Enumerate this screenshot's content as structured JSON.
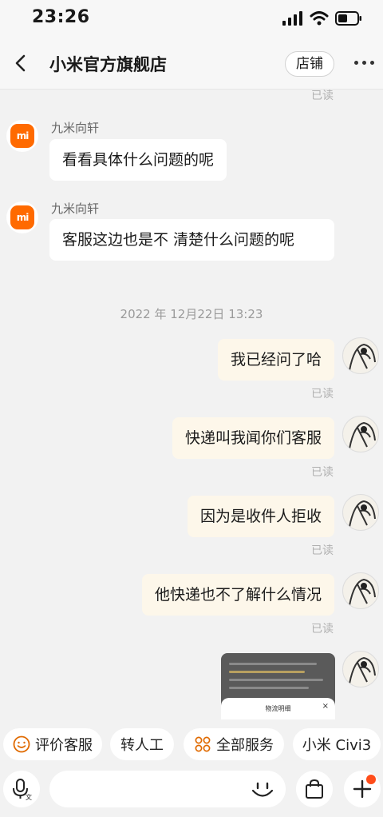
{
  "status_bar": {
    "time": "23:26"
  },
  "header": {
    "title": "小米官方旗舰店",
    "shop_button": "店铺"
  },
  "read_label": "已读",
  "messages": {
    "incoming": [
      {
        "sender": "九米向轩",
        "text": "看看具体什么问题的呢",
        "avatar": "mi-logo"
      },
      {
        "sender": "九米向轩",
        "text": "客服这边也是不 清楚什么问题的呢",
        "avatar": "mi-logo"
      }
    ],
    "timestamp": "2022 年 12月22日 13:23",
    "outgoing": [
      {
        "text": "我已经问了哈",
        "status": "已读"
      },
      {
        "text": "快递叫我闻你们客服",
        "status": "已读"
      },
      {
        "text": "因为是收件人拒收",
        "status": "已读"
      },
      {
        "text": "他快递也不了解什么情况",
        "status": "已读"
      }
    ],
    "image_message": {
      "sheet_title": "物流明细",
      "close": "×"
    }
  },
  "quick_actions": [
    {
      "label": "评价客服",
      "icon": "smile-icon"
    },
    {
      "label": "转人工",
      "icon": ""
    },
    {
      "label": "全部服务",
      "icon": "grid-icon"
    },
    {
      "label": "小米 Civi3",
      "icon": ""
    }
  ],
  "input_bar": {
    "voice_icon": "microphone-icon",
    "emoji_icon": "emoji-icon",
    "bag_icon": "shopping-bag-icon",
    "plus_icon": "plus-icon"
  },
  "colors": {
    "brand_orange": "#ff6a00",
    "outgoing_bubble": "#fdf7ea",
    "background": "#f2f2f2",
    "notify_dot": "#ff4d1a"
  }
}
